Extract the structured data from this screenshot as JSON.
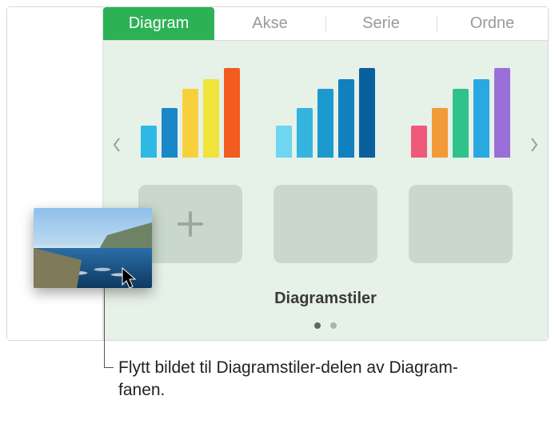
{
  "tabs": {
    "items": [
      {
        "label": "Diagram",
        "active": true
      },
      {
        "label": "Akse",
        "active": false
      },
      {
        "label": "Serie",
        "active": false
      },
      {
        "label": "Ordne",
        "active": false
      }
    ]
  },
  "section_label": "Diagramstiler",
  "styles_row1": [
    {
      "colors": [
        "#2eb8e6",
        "#1a87c9",
        "#f7d13d",
        "#f0e43a",
        "#f25c1f"
      ],
      "heights": [
        40,
        62,
        86,
        98,
        112
      ]
    },
    {
      "colors": [
        "#6ed6f0",
        "#34b5e0",
        "#1c9ad0",
        "#1080bf",
        "#0a5f9e"
      ],
      "heights": [
        40,
        62,
        86,
        98,
        112
      ]
    },
    {
      "colors": [
        "#f05a7a",
        "#f29a3a",
        "#2fc28a",
        "#2aa8e0",
        "#9a6fd8"
      ],
      "heights": [
        40,
        62,
        86,
        98,
        112
      ]
    }
  ],
  "page_dots": {
    "count": 2,
    "active_index": 0
  },
  "caption": "Flytt bildet til Diagramstiler-delen av Diagram-fanen."
}
